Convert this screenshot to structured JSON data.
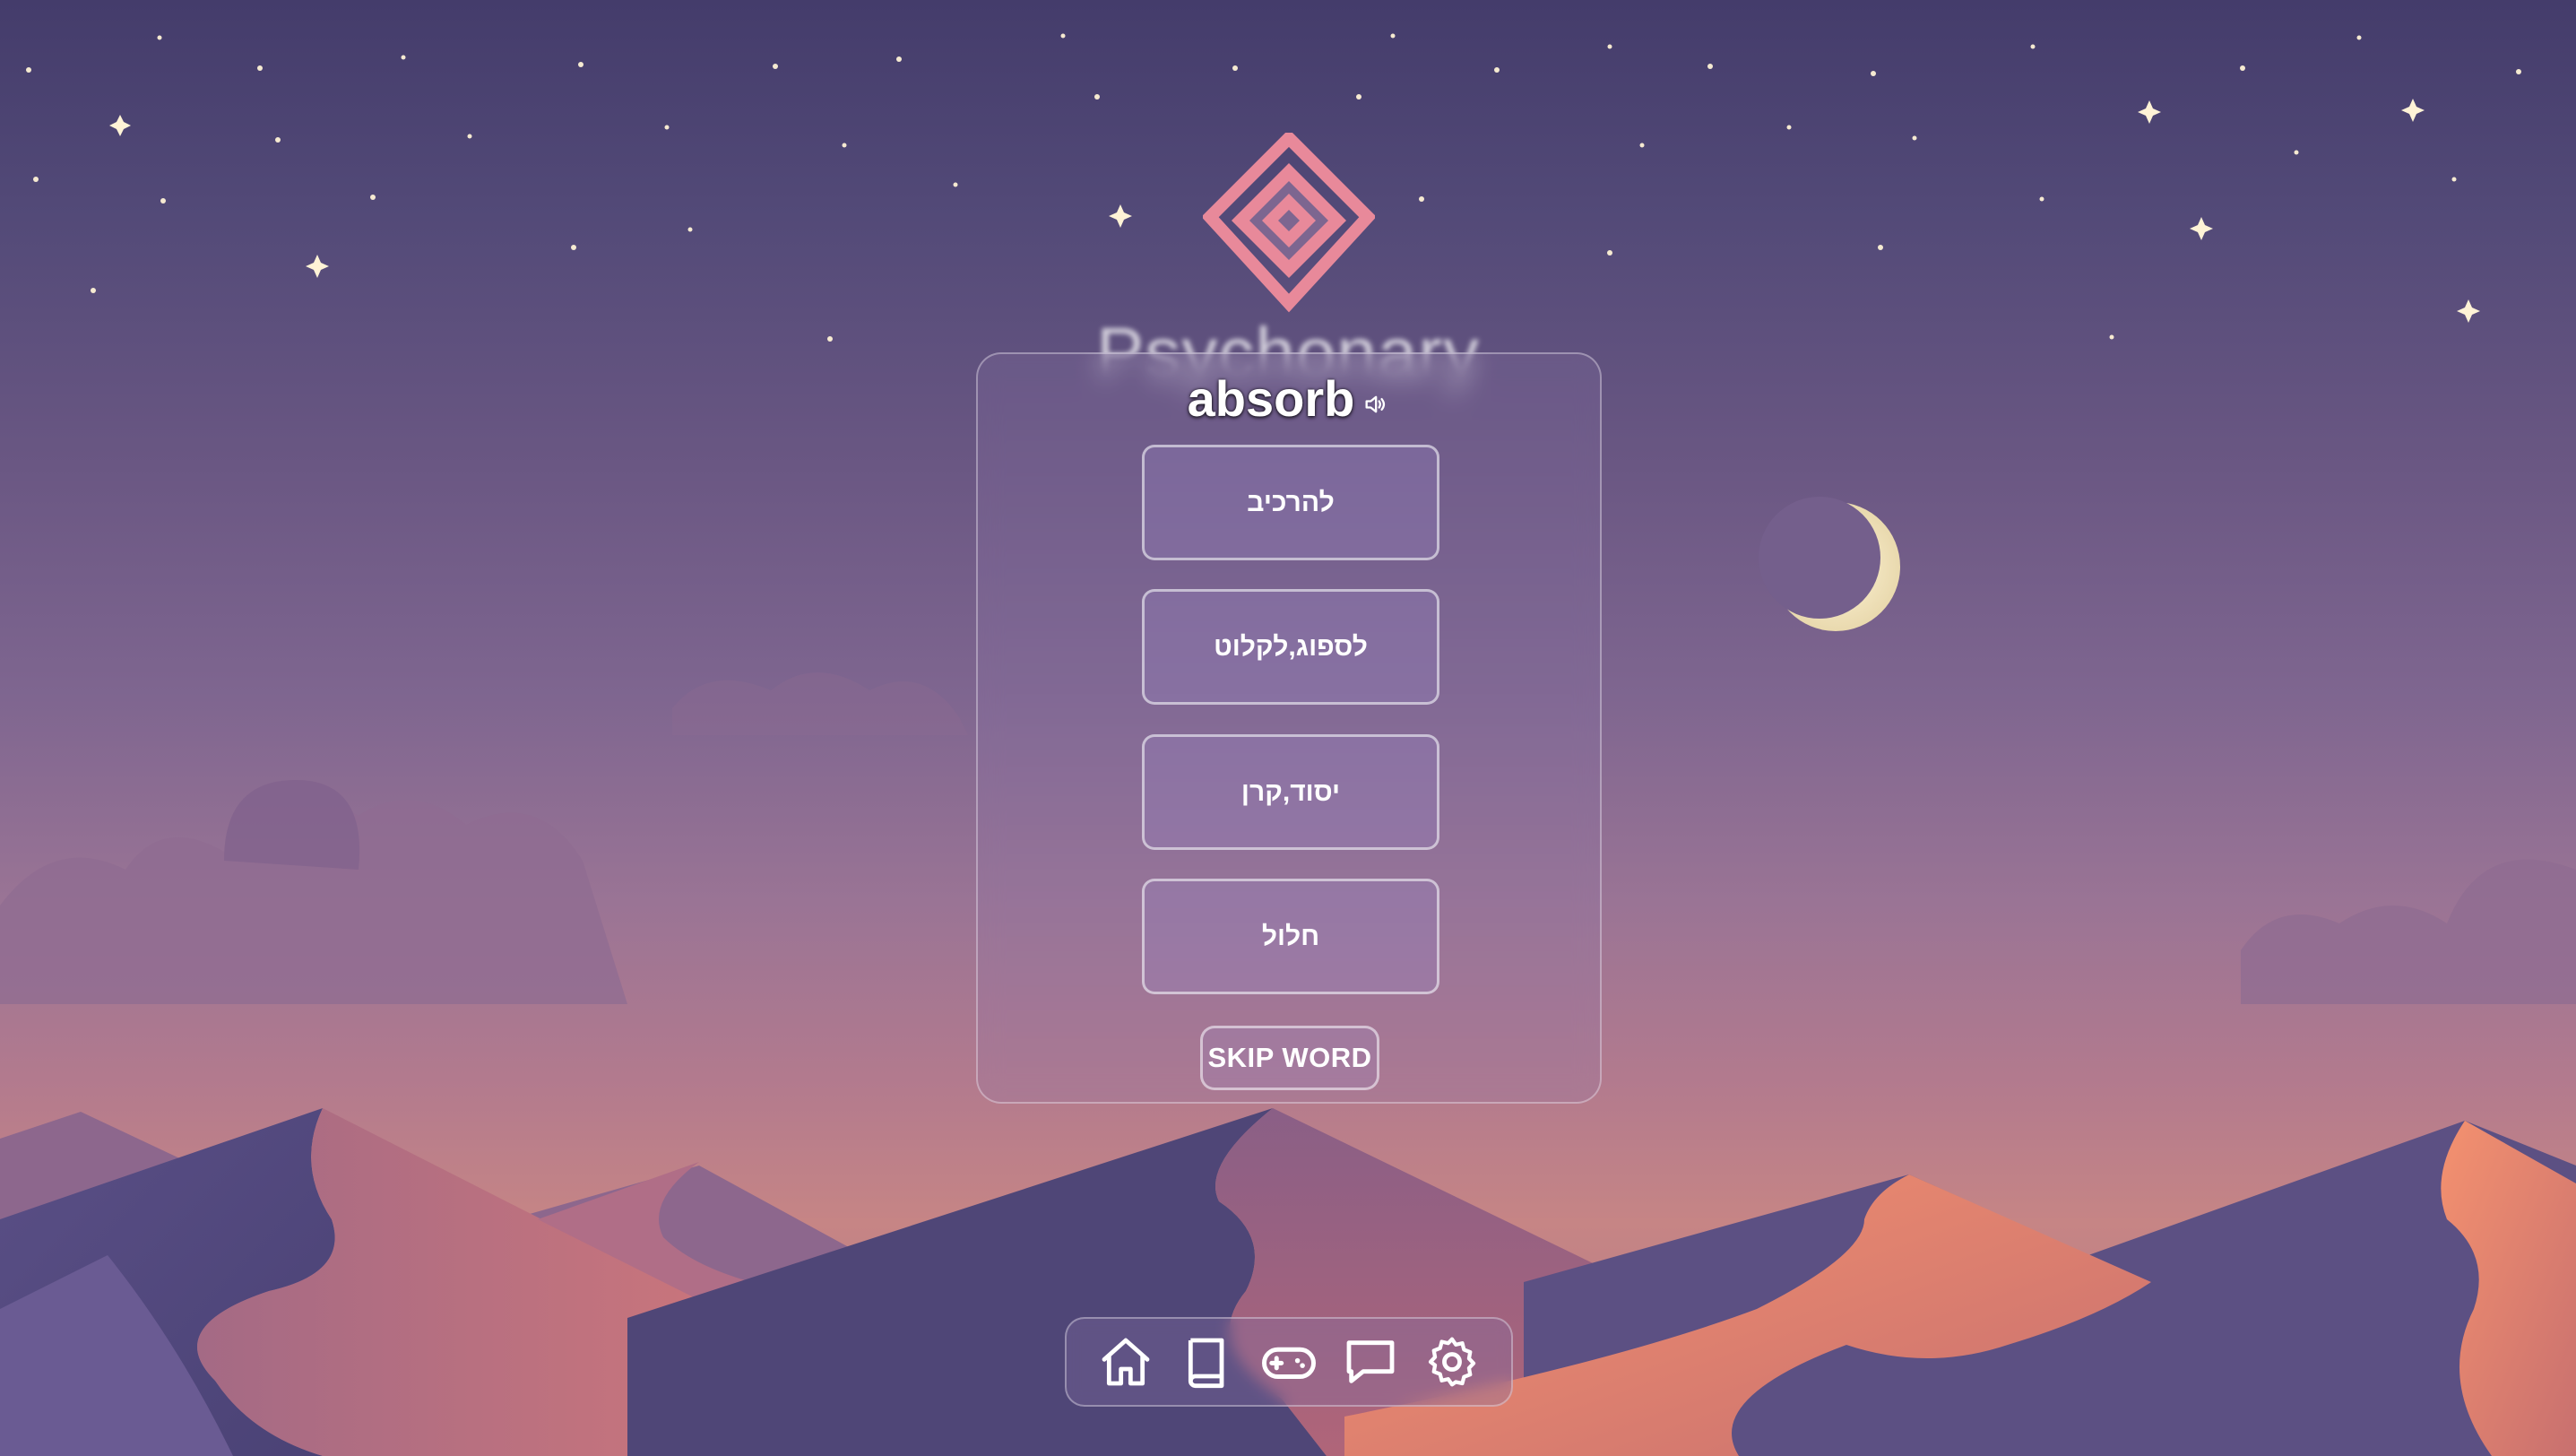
{
  "app": {
    "brand_name": "Psychonary"
  },
  "quiz": {
    "word": "absorb",
    "options": [
      "להרכיב",
      "לספוג,לקלוט",
      "יסוד,קרן",
      "חלול"
    ],
    "skip_label": "SKIP WORD"
  },
  "nav": {
    "items": [
      "home-icon",
      "book-icon",
      "gamepad-icon",
      "chat-icon",
      "settings-icon"
    ]
  },
  "colors": {
    "logo_pink": "#e8899a",
    "text": "#ffffff",
    "moon": "#f3e9c8"
  }
}
